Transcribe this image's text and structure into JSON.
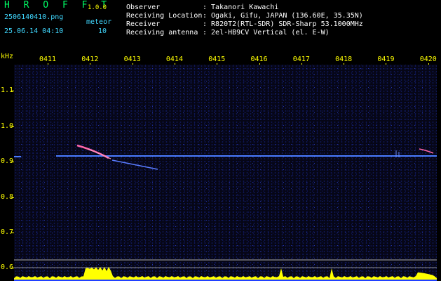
{
  "app": {
    "name": "H R O F F T",
    "version": "1.0.0",
    "filename": "2506140410.png",
    "datetime": "25.06.14 04:10",
    "meteor_label": "meteor",
    "meteor_count": "10"
  },
  "station": {
    "observer_label": "Observer",
    "observer_value": ": Takanori Kawachi",
    "location_label": "Receiving Location",
    "location_value": ": Ogaki, Gifu, JAPAN (136.60E, 35.35N)",
    "receiver_label": "Receiver",
    "receiver_value": ": R820T2(RTL-SDR) SDR-Sharp 53.1000MHz",
    "antenna_label": "Receiving antenna",
    "antenna_value": ": 2el-HB9CV Vertical (el. E-W)"
  },
  "spectrogram": {
    "unit_label": "kHz",
    "time_ticks": [
      "0411",
      "0412",
      "0413",
      "0414",
      "0415",
      "0416",
      "0417",
      "0418",
      "0419",
      "0420"
    ],
    "freq_ticks": [
      "1.1",
      "1.0",
      "0.9",
      "0.8",
      "0.7",
      "0.6"
    ],
    "colors": {
      "background": "#000000",
      "noise": "#1c2fa8",
      "carrier": "#4a7bff",
      "meteor": "#ff66aa",
      "level": "#ffff00",
      "axis": "#ffff00"
    }
  }
}
